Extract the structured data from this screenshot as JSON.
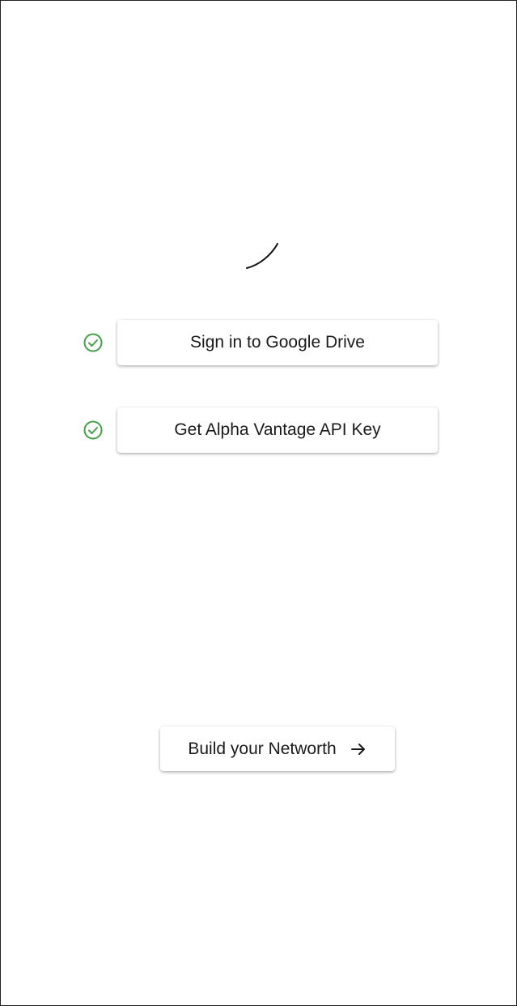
{
  "setup": {
    "steps": [
      {
        "label": "Sign in to Google Drive",
        "status_icon": "check-circle-icon",
        "completed": true
      },
      {
        "label": "Get Alpha Vantage API Key",
        "status_icon": "check-circle-icon",
        "completed": true
      }
    ],
    "build_button": {
      "label": "Build your Networth",
      "icon": "arrow-right-icon"
    }
  },
  "colors": {
    "success": "#43a047",
    "text": "#1a1a1a",
    "background": "#ffffff"
  },
  "loading_indicator": "spinner-icon"
}
